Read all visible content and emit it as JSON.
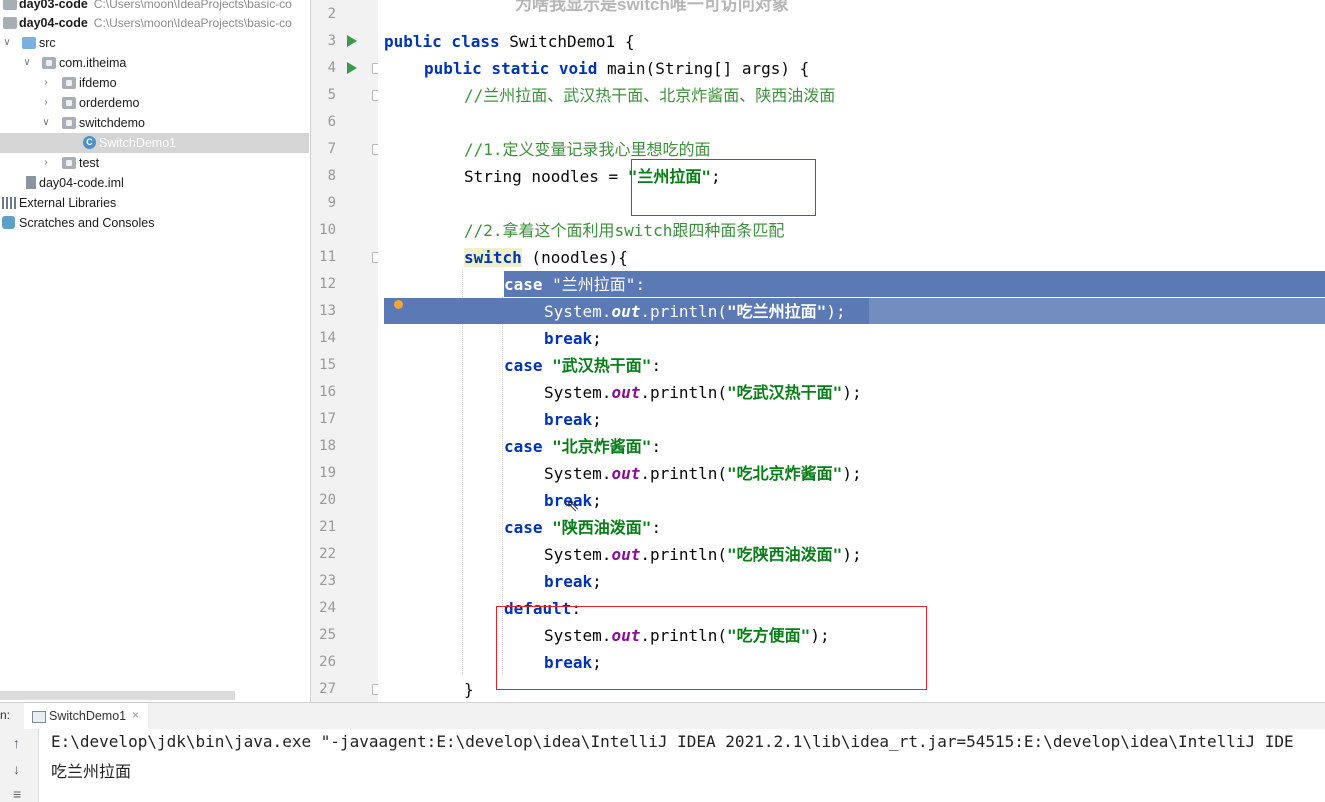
{
  "watermark": "为啥我显示是switch唯一可访问对象",
  "project_tree": {
    "items": [
      {
        "label": "day03-code",
        "path": "C:\\Users\\moon\\IdeaProjects\\basic-co"
      },
      {
        "label": "day04-code",
        "path": "C:\\Users\\moon\\IdeaProjects\\basic-co"
      },
      {
        "label": "src"
      },
      {
        "label": "com.itheima"
      },
      {
        "label": "ifdemo"
      },
      {
        "label": "orderdemo"
      },
      {
        "label": "switchdemo"
      },
      {
        "label": "SwitchDemo1"
      },
      {
        "label": "test"
      },
      {
        "label": "day04-code.iml"
      },
      {
        "label": "External Libraries"
      },
      {
        "label": "Scratches and Consoles"
      }
    ]
  },
  "editor": {
    "line_numbers": [
      "2",
      "3",
      "4",
      "5",
      "6",
      "7",
      "8",
      "9",
      "10",
      "11",
      "12",
      "13",
      "14",
      "15",
      "16",
      "17",
      "18",
      "19",
      "20",
      "21",
      "22",
      "23",
      "24",
      "25",
      "26",
      "27"
    ],
    "code": {
      "l3": {
        "kw1": "public class",
        "rest": " SwitchDemo1 {"
      },
      "l4": {
        "kw1": "public static void",
        "rest": " main(String[] args) {"
      },
      "l5": "//兰州拉面、武汉热干面、北京炸酱面、陕西油泼面",
      "l7": "//1.定义变量记录我心里想吃的面",
      "l8": {
        "pre": "String noodles = ",
        "str": "\"兰州拉面\"",
        "post": ";"
      },
      "l10": "//2.拿着这个面利用switch跟四种面条匹配",
      "l11": {
        "kw": "switch",
        "rest": " (noodles){"
      },
      "l12": {
        "kw": "case",
        "str": " \"兰州拉面\"",
        "post": ":"
      },
      "l13": {
        "pre": "System.",
        "fld": "out",
        "mid": ".println(",
        "str": "\"吃兰州拉面\"",
        "post": ");"
      },
      "l14": {
        "kw": "break",
        "post": ";"
      },
      "l15": {
        "kw": "case",
        "str": " \"武汉热干面\"",
        "post": ":"
      },
      "l16": {
        "pre": "System.",
        "fld": "out",
        "mid": ".println(",
        "str": "\"吃武汉热干面\"",
        "post": ");"
      },
      "l17": {
        "kw": "break",
        "post": ";"
      },
      "l18": {
        "kw": "case",
        "str": " \"北京炸酱面\"",
        "post": ":"
      },
      "l19": {
        "pre": "System.",
        "fld": "out",
        "mid": ".println(",
        "str": "\"吃北京炸酱面\"",
        "post": ");"
      },
      "l20": {
        "kw": "break",
        "post": ";"
      },
      "l21": {
        "kw": "case",
        "str": " \"陕西油泼面\"",
        "post": ":"
      },
      "l22": {
        "pre": "System.",
        "fld": "out",
        "mid": ".println(",
        "str": "\"吃陕西油泼面\"",
        "post": ");"
      },
      "l23": {
        "kw": "break",
        "post": ";"
      },
      "l24": {
        "kw": "default",
        "post": ":"
      },
      "l25": {
        "pre": "System.",
        "fld": "out",
        "mid": ".println(",
        "str": "\"吃方便面\"",
        "post": ");"
      },
      "l26": {
        "kw": "break",
        "post": ";"
      },
      "l27": "}"
    }
  },
  "run_panel": {
    "label": "n:",
    "tab": "SwitchDemo1",
    "tab_close": "×",
    "output": [
      "E:\\develop\\jdk\\bin\\java.exe \"-javaagent:E:\\develop\\idea\\IntelliJ IDEA 2021.2.1\\lib\\idea_rt.jar=54515:E:\\develop\\idea\\IntelliJ IDE",
      "吃兰州拉面"
    ]
  },
  "colors": {
    "selection": "#5a79b5",
    "keyword": "#0033b3",
    "string": "#067d17",
    "comment": "#3e8f3e",
    "annotation_box": "#e0232a"
  }
}
